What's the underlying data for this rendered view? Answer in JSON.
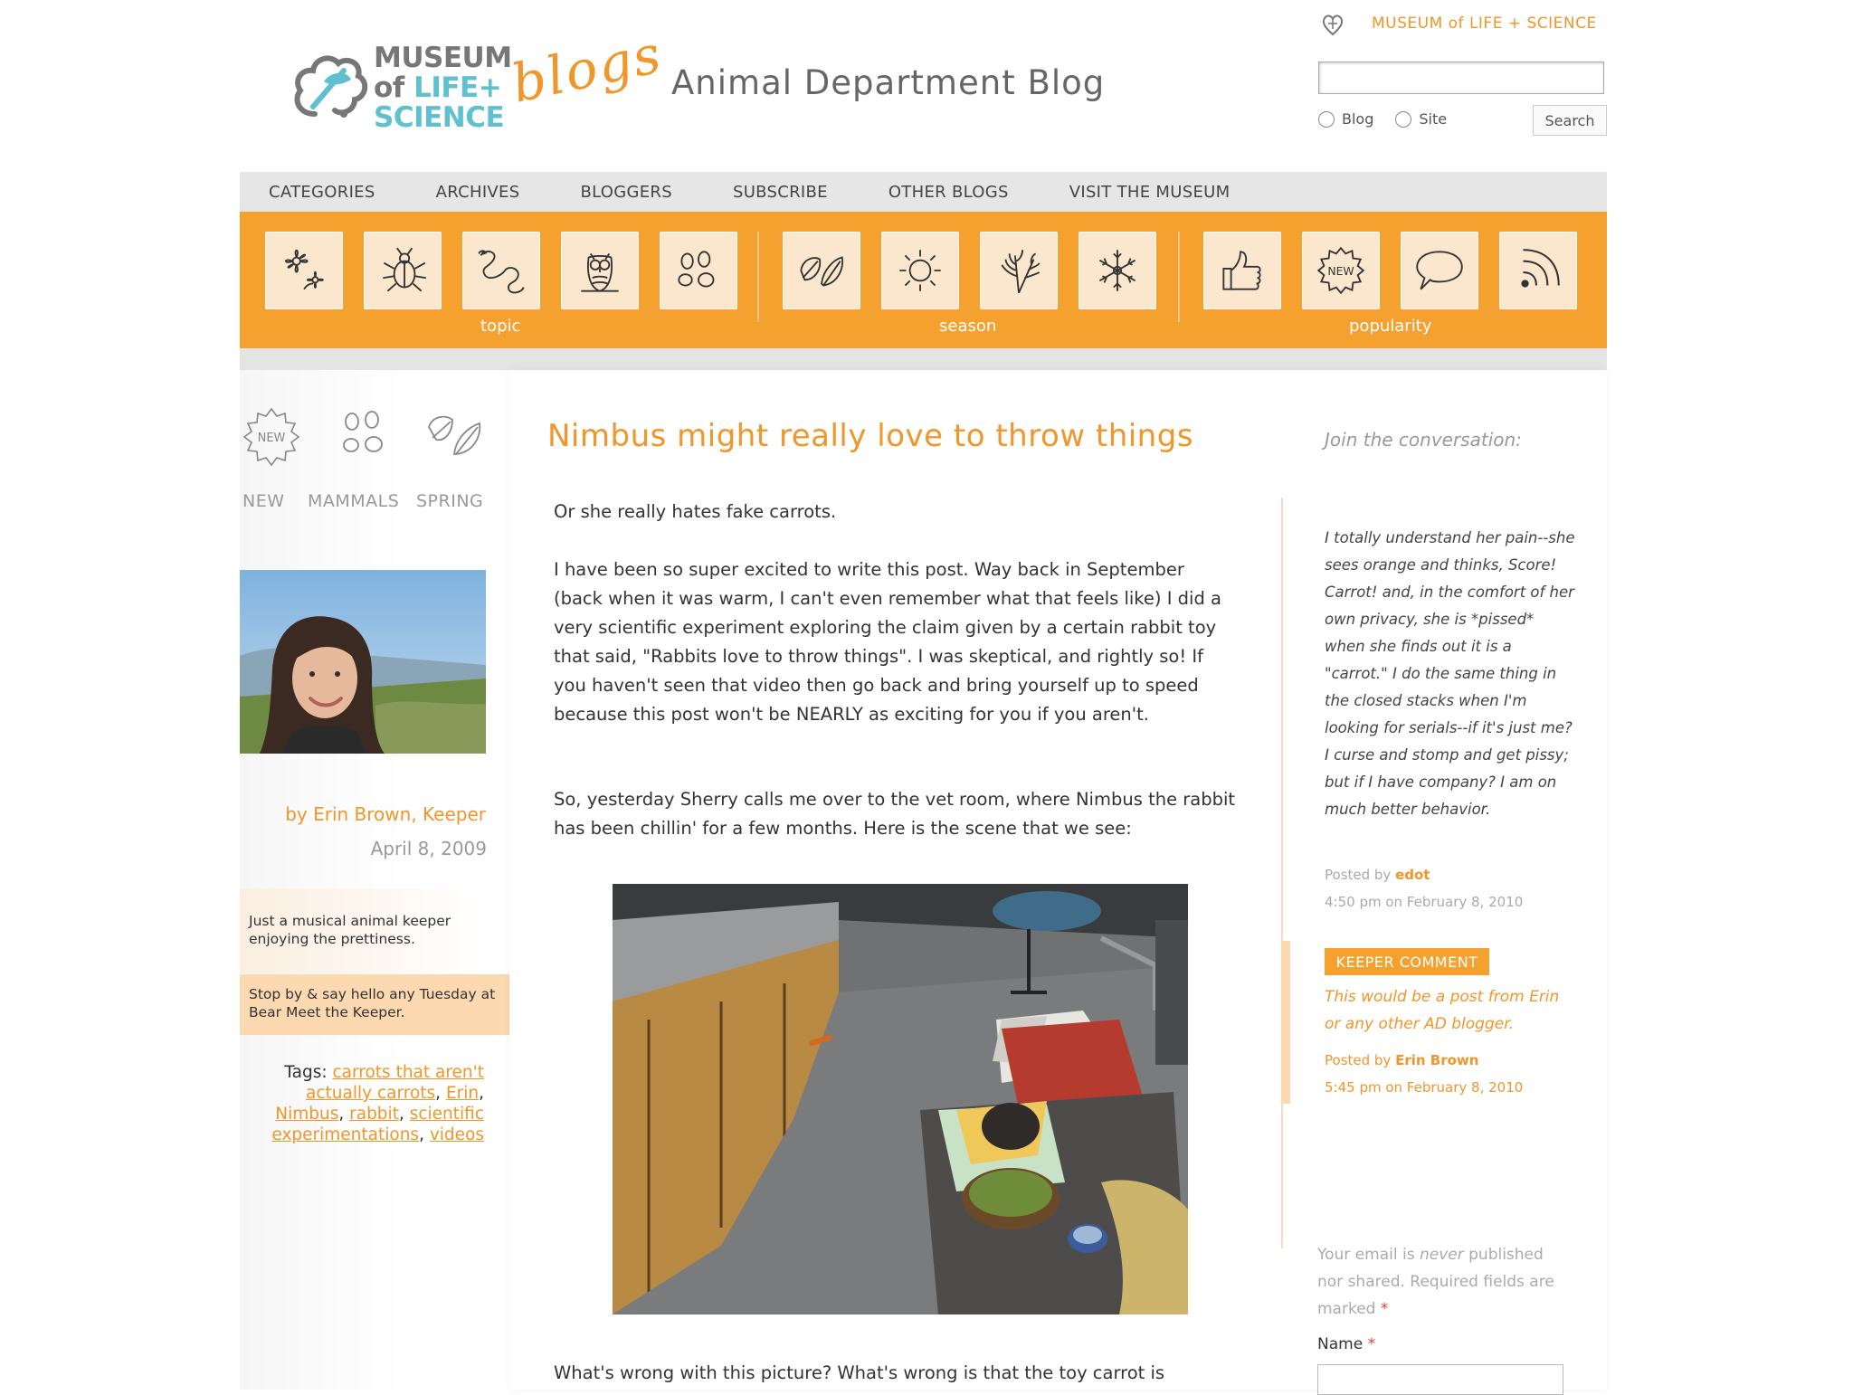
{
  "header": {
    "logo": {
      "line1": "MUSEUM",
      "line2_a": "of ",
      "line2_b": "LIFE+",
      "line3": "SCIENCE"
    },
    "blogs_script": "blogs",
    "blog_title": "Animal Department Blog",
    "top_link": "MUSEUM of LIFE + SCIENCE",
    "search": {
      "input_value": "",
      "radio_blog": "Blog",
      "radio_site": "Site",
      "button_label": "Search"
    }
  },
  "nav": {
    "items": [
      "CATEGORIES",
      "ARCHIVES",
      "BLOGGERS",
      "SUBSCRIBE",
      "OTHER BLOGS",
      "VISIT THE MUSEUM"
    ]
  },
  "iconbar": {
    "groups": [
      {
        "label": "topic",
        "icons": [
          "flower-icon",
          "beetle-icon",
          "snake-icon",
          "owl-icon",
          "paw-print-icon"
        ]
      },
      {
        "label": "season",
        "icons": [
          "leaf-icon",
          "sun-icon",
          "wheat-icon",
          "snowflake-icon"
        ]
      },
      {
        "label": "popularity",
        "icons": [
          "thumbs-up-icon",
          "new-badge-icon",
          "speech-bubble-icon",
          "rss-icon"
        ]
      }
    ]
  },
  "post_categories": [
    {
      "label": "NEW",
      "icon": "new-badge-icon"
    },
    {
      "label": "MAMMALS",
      "icon": "paw-print-icon"
    },
    {
      "label": "SPRING",
      "icon": "leaf-icon"
    }
  ],
  "author": {
    "byline": "by Erin Brown, Keeper",
    "date": "April 8, 2009",
    "bio": "Just a musical animal keeper enjoying the prettiness.",
    "note": "Stop by & say hello any Tuesday at Bear Meet the Keeper."
  },
  "tags": {
    "label": "Tags:",
    "items": [
      "carrots that aren't actually carrots",
      "Erin",
      "Nimbus",
      "rabbit",
      "scientific experimentations",
      "videos"
    ]
  },
  "post": {
    "title": "Nimbus might really love to throw things",
    "paragraphs": [
      "Or she really hates fake carrots.",
      "I have been so super excited to write this post. Way back in September (back when it was warm, I can't even remember what that feels like) I did a very scientific experiment exploring the claim given by a certain rabbit toy that said, \"Rabbits love to throw things\". I was skeptical, and rightly so! If you haven't seen that video then go back and bring yourself up to speed because this post won't be NEARLY as exciting for you if you aren't.",
      "So, yesterday Sherry calls me over to the vet room, where Nimbus the rabbit has been chillin' for a few months. Here is the scene that we see:",
      "What's wrong with this picture? What's wrong is that the toy carrot is"
    ]
  },
  "comments": {
    "join_label": "Join the conversation:",
    "items": [
      {
        "text": "I totally understand her pain--she sees orange and thinks, Score! Carrot! and, in the comfort of her own privacy, she is *pissed* when she finds out it is a \"carrot.\" I do the same thing in the closed stacks when I'm looking for serials--if it's just me? I curse and stomp and get pissy; but if I have company? I am on much better behavior.",
        "posted_by_label": "Posted by",
        "author": "edot",
        "time": "4:50 pm on February 8, 2010"
      }
    ],
    "keeper_comment": {
      "badge": "KEEPER COMMENT",
      "text": "This would be a post from Erin or any other AD blogger.",
      "posted_by_label": "Posted by",
      "author": "Erin Brown",
      "time": "5:45 pm on February 8, 2010"
    },
    "form": {
      "email_note_a": "Your email is",
      "email_note_never": "never",
      "email_note_b": "published nor shared. Required fields are marked",
      "required_mark": "*",
      "name_label": "Name",
      "name_value": ""
    }
  },
  "colors": {
    "accent_orange": "#f5a130",
    "link_orange": "#f0962a",
    "nav_gray": "#e6e6e6",
    "logo_teal": "#5fc0d0"
  }
}
